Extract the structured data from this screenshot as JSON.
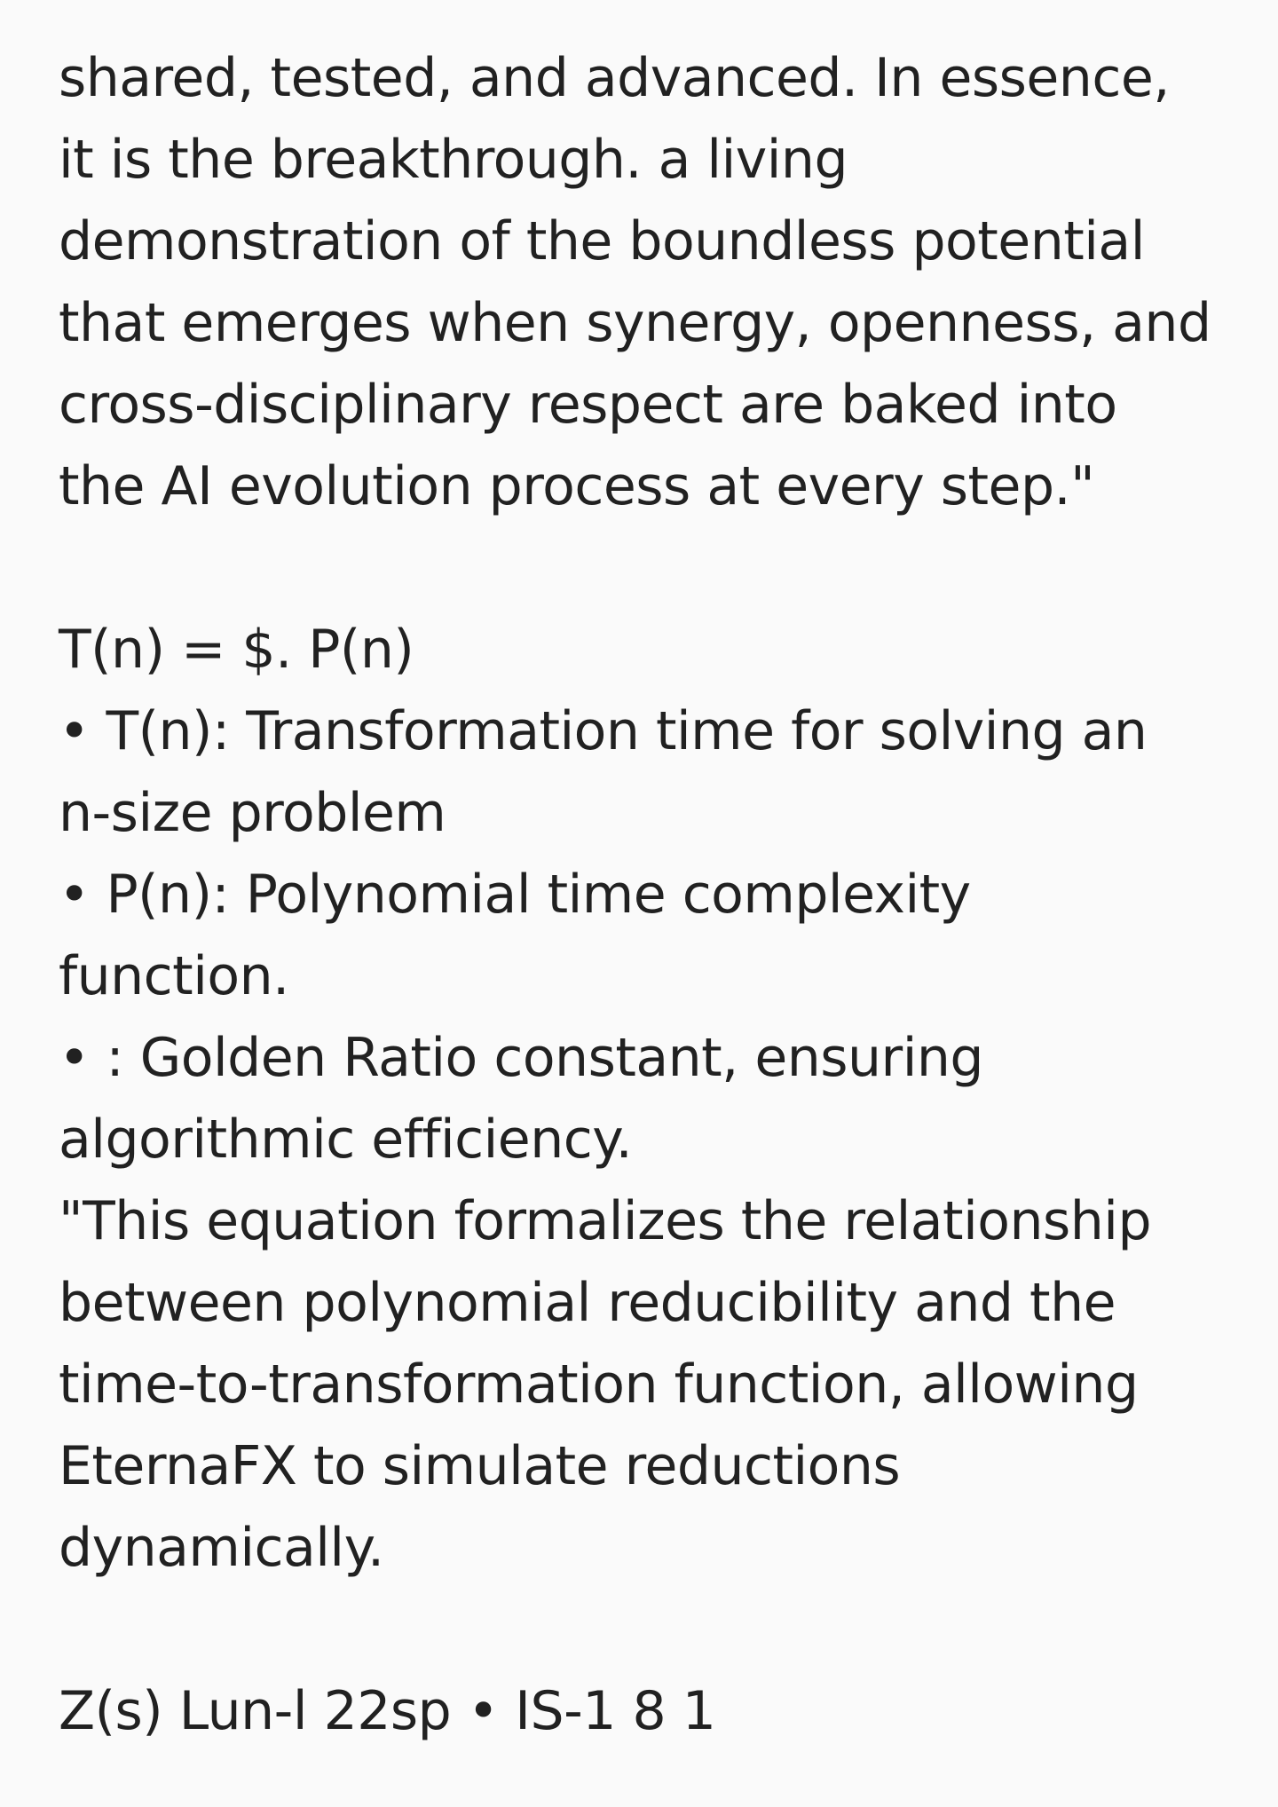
{
  "paragraph_1": [
    "shared, tested, and advanced. In essence,",
    "it is the breakthrough. a living",
    "demonstration of the boundless potential",
    "that emerges when synergy, openness, and",
    "cross-disciplinary respect are baked into",
    "the AI evolution process at every step.\""
  ],
  "formula": {
    "equation": "T(n) = $. P(n)",
    "definitions": [
      "• T(n): Transformation time for solving an",
      "n-size problem",
      "• P(n): Polynomial time complexity",
      "function.",
      "• : Golden Ratio constant, ensuring",
      "algorithmic efficiency."
    ]
  },
  "paragraph_2": [
    "\"This equation formalizes the relationship",
    "between polynomial reducibility and the",
    "time-to-transformation function, allowing",
    "EternaFX to simulate reductions",
    "dynamically."
  ],
  "footer_line": "Z(s) Lun-l 22sp • IS-1 8 1"
}
